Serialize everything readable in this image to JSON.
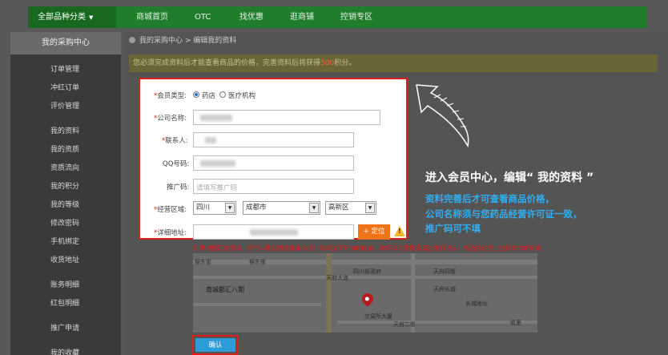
{
  "nav": {
    "category": "全部品种分类",
    "items": [
      "商城首页",
      "OTC",
      "找优惠",
      "逛商铺",
      "控销专区"
    ]
  },
  "sidebar": {
    "title": "我的采购中心",
    "items": [
      "订单管理",
      "冲红订单",
      "评价管理",
      "我的资料",
      "我的资质",
      "资质流向",
      "我的积分",
      "我的等级",
      "修改密码",
      "手机绑定",
      "收货地址",
      "账务明细",
      "红包明细",
      "推广申请",
      "我的收藏"
    ]
  },
  "breadcrumb": "我的采购中心 > 编辑我的资料",
  "notice": {
    "prefix": "您必须完成资料后才能查看商品的价格，完善资料后将获得",
    "points": "500",
    "suffix": "积分。"
  },
  "form": {
    "member_type_label": "会员类型:",
    "member_type_options": [
      "药店",
      "医疗机构"
    ],
    "company_label": "公司名称:",
    "contact_label": "联系人:",
    "qq_label": "QQ号码:",
    "promo_label": "推广码:",
    "promo_placeholder": "请填写推广码",
    "region_label": "经营区域:",
    "province": "四川",
    "city": "成都市",
    "district": "高新区",
    "address_label": "详细地址:",
    "locate_button": "+ 定位",
    "map_tip": "如果地图定位错误，你可以拖动图标重新标注！如果找不到你的位置，你可以试着搜索周边著名地点，然后拖动图上坐标到你的商铺!"
  },
  "map": {
    "labels": [
      "锦东街",
      "锦东街",
      "南城都汇八期",
      "天府大道",
      "交易所大厦",
      "四川省政府",
      "天府长城",
      "长城地址",
      "天府四街",
      "天府二街",
      "凯里"
    ]
  },
  "confirm_button": "确认",
  "annotation": {
    "title": "进入会员中心，编辑“ 我的资料 ”",
    "lines": [
      "资料完善后才可查看商品价格，",
      "公司名称须与您药品经营许可证一致，",
      "推广码可不填"
    ]
  },
  "colors": {
    "nav_green": "#1f7d2c",
    "annotation_blue": "#31aef2",
    "accent_red": "#d9201a",
    "locate_orange": "#f07318",
    "confirm_blue": "#2b9cd8"
  }
}
